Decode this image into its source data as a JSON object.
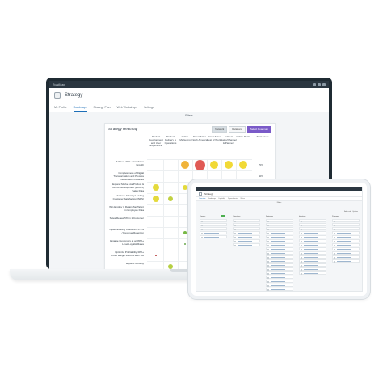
{
  "laptop": {
    "topbar": {
      "brand": "RoadMap"
    },
    "header": {
      "title": "Strategy"
    },
    "tabs": [
      "My Profile",
      "Roadmaps",
      "Strategy Plan",
      "Web Workshops",
      "Settings"
    ],
    "active_tab": 1,
    "filter_label": "Filters",
    "heatmap": {
      "title": "Strategy Heatmap",
      "buttons": {
        "toggle_a": "Network",
        "toggle_b": "Relations",
        "primary": "Select Roadmap"
      },
      "columns": [
        "Product Development and User Experience",
        "Product Delivery & Operations",
        "Online Marketing",
        "Direct Sales North America",
        "Direct Sales Rest of World",
        "Indirect Sales/Channel & Partners",
        "Online Retail"
      ],
      "score_header": "Total Score",
      "rows": [
        {
          "label": "Achieve 40%+ New Sales Growth",
          "score": "70%"
        },
        {
          "label": "Completeness of Digital Transformation and Process Automation Initiatives",
          "score": "50%"
        },
        {
          "label": "Expand Market via Product & Brand Development ($50m+) Sales Data",
          "score": ""
        },
        {
          "label": "Achieve Industry Leading Customer Satisfaction (NPS)",
          "score": ""
        },
        {
          "label": "Win Employ & Retain Top Talent in Employee Data",
          "score": ""
        },
        {
          "label": "Sales/Renew 5% in 1 Customer",
          "score": ""
        },
        {
          "label": "Upsell Existing Customers 2.5% / Revenue Retention",
          "score": ""
        },
        {
          "label": "Engage Customers at an 80%+ Level Loyalist Rates",
          "score": ""
        },
        {
          "label": "Optimize Profitability 30%+ Gross Margin & 10%+ EBITDA",
          "score": ""
        },
        {
          "label": "Expand Globally",
          "score": ""
        }
      ],
      "cells": [
        {
          "row": 0,
          "col": 2,
          "size": "lg",
          "color": "#f0b33a"
        },
        {
          "row": 0,
          "col": 3,
          "size": "xl",
          "color": "#e05a55"
        },
        {
          "row": 0,
          "col": 4,
          "size": "lg",
          "color": "#f1d936"
        },
        {
          "row": 0,
          "col": 5,
          "size": "lg",
          "color": "#f1d936"
        },
        {
          "row": 0,
          "col": 6,
          "size": "lg",
          "color": "#f1d936"
        },
        {
          "row": 2,
          "col": 0,
          "size": "md",
          "color": "#e4da3c"
        },
        {
          "row": 2,
          "col": 2,
          "size": "sm",
          "color": "#e4da3c"
        },
        {
          "row": 3,
          "col": 0,
          "size": "md",
          "color": "#e4da3c"
        },
        {
          "row": 3,
          "col": 1,
          "size": "sm",
          "color": "#c1d142"
        },
        {
          "row": 6,
          "col": 2,
          "size": "xs",
          "color": "#77b845"
        },
        {
          "row": 7,
          "col": 2,
          "size": "xxs",
          "color": "#6aa84f"
        },
        {
          "row": 8,
          "col": 0,
          "size": "xxs",
          "color": "#b03030"
        },
        {
          "row": 9,
          "col": 1,
          "size": "sm",
          "color": "#b6cf43"
        }
      ]
    }
  },
  "tablet": {
    "header": {
      "title": "Strategy"
    },
    "tabs": [
      "Overview",
      "Roadmaps",
      "Capability",
      "Dependencies",
      "Notes"
    ],
    "active_tab": 0,
    "filter_label": "Filters",
    "actions": [
      "Add card",
      "Options"
    ],
    "columns": [
      {
        "title": "Themes",
        "cards": 5
      },
      {
        "title": "Objectives",
        "cards": 7
      },
      {
        "title": "Strategies",
        "cards": 18
      },
      {
        "title": "Initiatives",
        "cards": 14
      },
      {
        "title": "Programs",
        "cards": 11
      }
    ]
  }
}
